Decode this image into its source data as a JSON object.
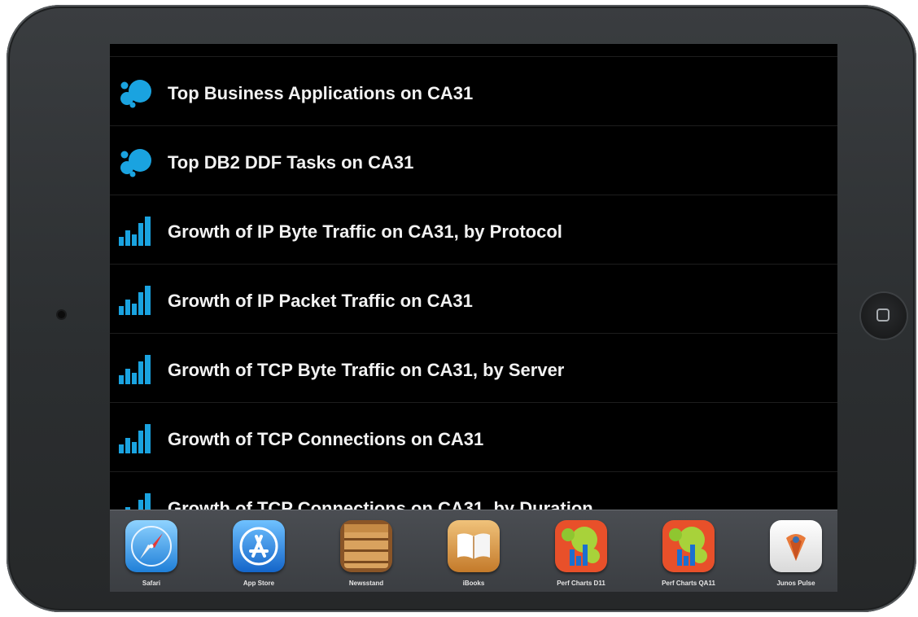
{
  "list": {
    "items": [
      {
        "label": "Top Business Applications on CA31",
        "icon": "bubbles-icon"
      },
      {
        "label": "Top DB2 DDF Tasks on CA31",
        "icon": "bubbles-icon"
      },
      {
        "label": "Growth of IP Byte Traffic on CA31, by Protocol",
        "icon": "bar-chart-icon"
      },
      {
        "label": "Growth of IP Packet Traffic on CA31",
        "icon": "bar-chart-icon"
      },
      {
        "label": "Growth of TCP Byte Traffic on CA31, by Server",
        "icon": "bar-chart-icon"
      },
      {
        "label": "Growth of TCP Connections on CA31",
        "icon": "bar-chart-icon"
      },
      {
        "label": "Growth of TCP Connections on CA31, by Duration",
        "icon": "bar-chart-icon"
      }
    ]
  },
  "dock": {
    "apps": [
      {
        "label": "Safari",
        "icon": "safari-compass-icon"
      },
      {
        "label": "App Store",
        "icon": "app-store-icon"
      },
      {
        "label": "Newsstand",
        "icon": "newsstand-shelf-icon"
      },
      {
        "label": "iBooks",
        "icon": "ibooks-book-icon"
      },
      {
        "label": "Perf Charts D11",
        "icon": "perf-charts-icon"
      },
      {
        "label": "Perf Charts QA11",
        "icon": "perf-charts-icon"
      },
      {
        "label": "Junos Pulse",
        "icon": "junos-pulse-icon"
      }
    ]
  },
  "colors": {
    "icon_blue": "#1aa3e0",
    "screen_background": "#000000",
    "label_text": "#f2f2f2"
  }
}
